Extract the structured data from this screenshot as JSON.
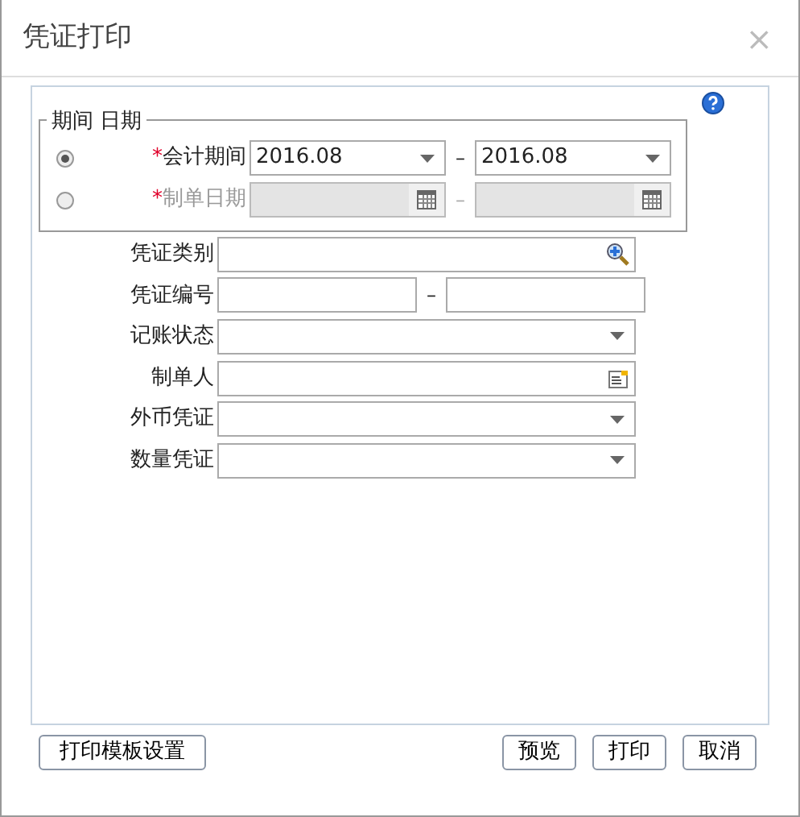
{
  "window": {
    "title": "凭证打印",
    "close": "×"
  },
  "group": {
    "title": "期间 日期",
    "options": [
      {
        "kind": "select",
        "label": "会计期间",
        "required_mark": "*",
        "selected": true,
        "disabled": false,
        "from": "2016.08",
        "to": "2016.08",
        "separator": "–"
      },
      {
        "kind": "date",
        "label": "制单日期",
        "required_mark": "*",
        "selected": false,
        "disabled": true,
        "separator": "–"
      }
    ]
  },
  "fields": [
    {
      "kind": "lookup",
      "label": "凭证类别"
    },
    {
      "kind": "range",
      "label": "凭证编号",
      "separator": "–"
    },
    {
      "kind": "select",
      "label": "记账状态"
    },
    {
      "kind": "picker",
      "label": "制单人"
    },
    {
      "kind": "select",
      "label": "外币凭证"
    },
    {
      "kind": "select",
      "label": "数量凭证"
    }
  ],
  "buttons": [
    {
      "label": "打印模板设置",
      "kind": "setup"
    },
    {
      "label": "预览",
      "kind": "action"
    },
    {
      "label": "打印",
      "kind": "action"
    },
    {
      "label": "取消",
      "kind": "action"
    }
  ]
}
